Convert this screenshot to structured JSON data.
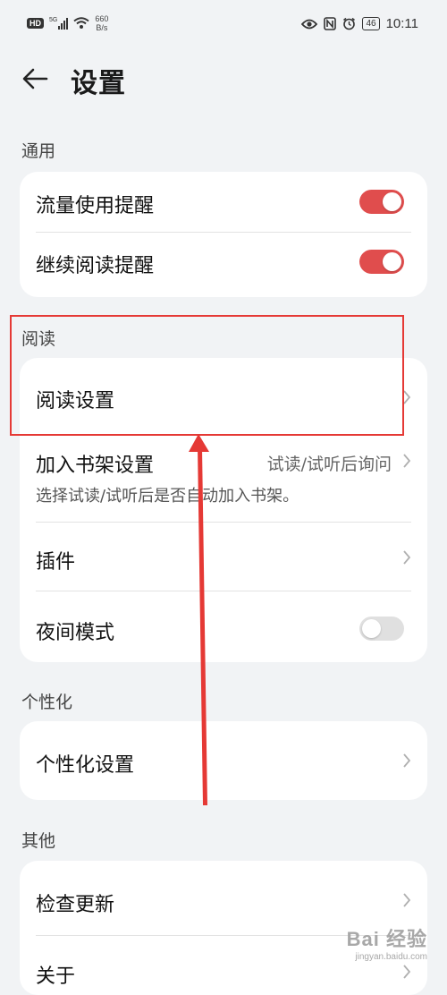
{
  "status_bar": {
    "hd_badge": "HD",
    "network": "5G",
    "speed_value": "660",
    "speed_unit": "B/s",
    "battery": "46",
    "time": "10:11",
    "icons": [
      "eye-icon",
      "nfc-icon",
      "alarm-icon"
    ]
  },
  "header": {
    "title": "设置"
  },
  "sections": {
    "general": {
      "label": "通用",
      "items": [
        {
          "label": "流量使用提醒",
          "toggle": true
        },
        {
          "label": "继续阅读提醒",
          "toggle": true
        }
      ]
    },
    "reading": {
      "label": "阅读",
      "items": [
        {
          "label": "阅读设置"
        },
        {
          "label": "加入书架设置",
          "value": "试读/试听后询问",
          "subtext": "选择试读/试听后是否自动加入书架。"
        },
        {
          "label": "插件"
        },
        {
          "label": "夜间模式",
          "toggle": false
        }
      ]
    },
    "personal": {
      "label": "个性化",
      "items": [
        {
          "label": "个性化设置"
        }
      ]
    },
    "other": {
      "label": "其他",
      "items": [
        {
          "label": "检查更新"
        },
        {
          "label": "关于"
        }
      ]
    }
  },
  "watermark": {
    "brand": "Bai 经验",
    "url": "jingyan.baidu.com"
  },
  "colors": {
    "accent": "#e04d4d",
    "annotation": "#e53935",
    "background": "#f1f3f5"
  }
}
